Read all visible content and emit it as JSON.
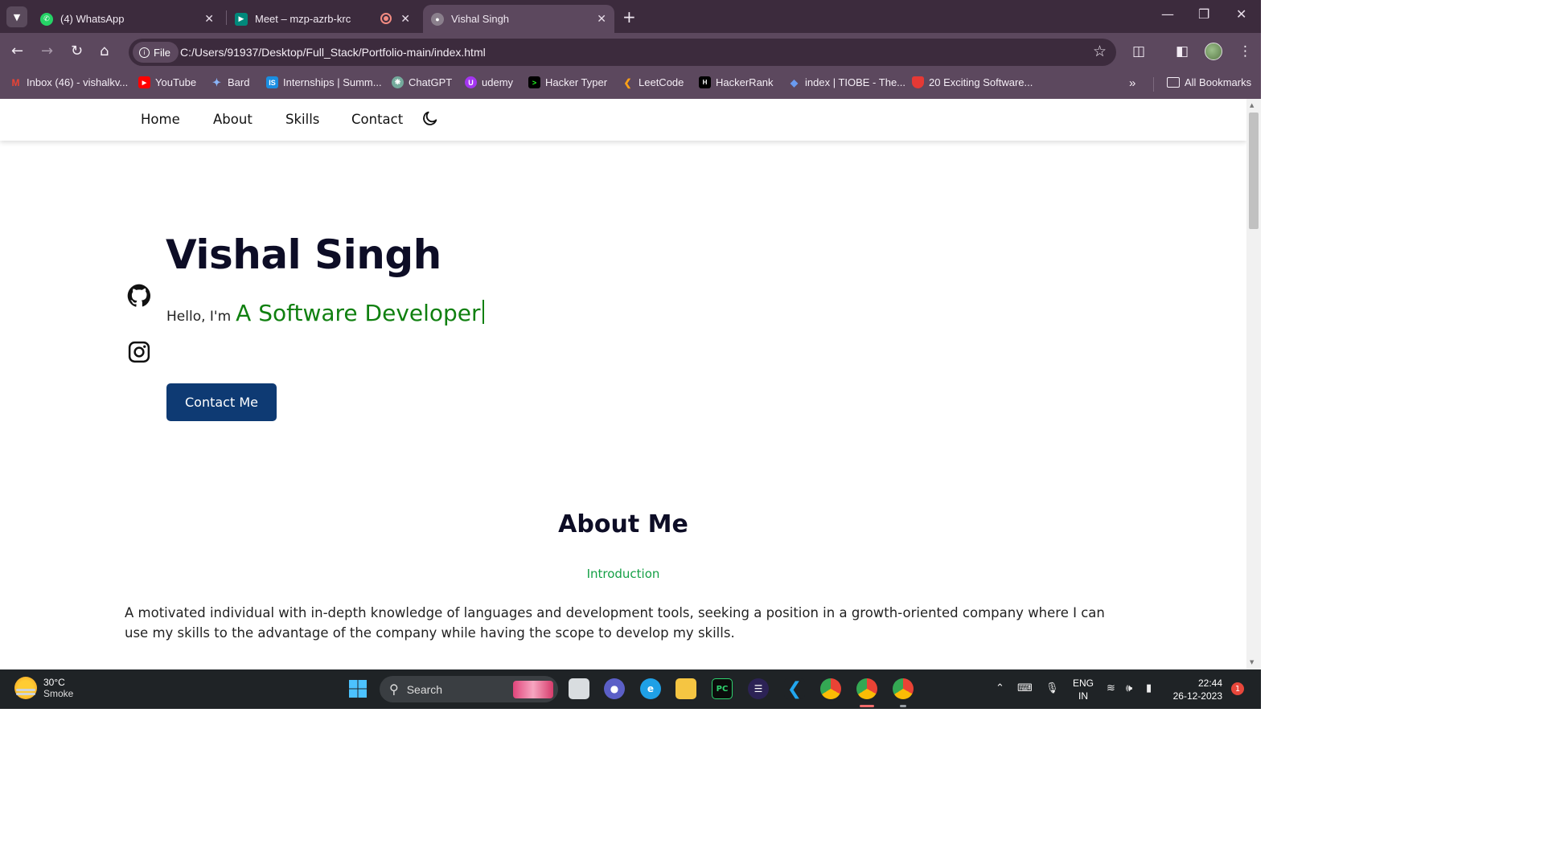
{
  "browser": {
    "tabs": [
      {
        "title": "(4) WhatsApp",
        "favicon": "whatsapp-icon",
        "color": "#25d366"
      },
      {
        "title": "Meet – mzp-azrb-krc",
        "favicon": "google-meet-icon",
        "color": "#00897b"
      },
      {
        "title": "Vishal Singh",
        "favicon": "globe-icon",
        "color": "#8a7f8c",
        "active": true
      }
    ],
    "address": {
      "scheme_label": "File",
      "url": "C:/Users/91937/Desktop/Full_Stack/Portfolio-main/index.html"
    },
    "bookmarks": [
      {
        "label": "Inbox (46) - vishalkv...",
        "icon": "gmail-icon",
        "color": "#ea4335"
      },
      {
        "label": "YouTube",
        "icon": "youtube-icon",
        "color": "#ff0000"
      },
      {
        "label": "Bard",
        "icon": "bard-icon",
        "color": "#8ab4f8"
      },
      {
        "label": "Internships | Summ...",
        "icon": "internshala-icon",
        "color": "#1a8ee1"
      },
      {
        "label": "ChatGPT",
        "icon": "chatgpt-icon",
        "color": "#74aa9c"
      },
      {
        "label": "udemy",
        "icon": "udemy-icon",
        "color": "#a435f0"
      },
      {
        "label": "Hacker Typer",
        "icon": "terminal-icon",
        "color": "#000000"
      },
      {
        "label": "LeetCode",
        "icon": "leetcode-icon",
        "color": "#ffa116"
      },
      {
        "label": "HackerRank",
        "icon": "hackerrank-icon",
        "color": "#000000"
      },
      {
        "label": "index | TIOBE - The...",
        "icon": "tiobe-icon",
        "color": "#3a6fd8"
      },
      {
        "label": "20 Exciting Software...",
        "icon": "bookmark-page-icon",
        "color": "#e53935"
      }
    ],
    "all_bookmarks_label": "All Bookmarks"
  },
  "site": {
    "nav": [
      "Home",
      "About",
      "Skills",
      "Contact"
    ],
    "hero": {
      "name": "Vishal Singh",
      "greeting": "Hello, I'm",
      "role": "A Software Developer",
      "cta": "Contact Me"
    },
    "about": {
      "title": "About Me",
      "subtitle": "Introduction",
      "text": "A motivated individual with in-depth knowledge of languages and development tools, seeking a position in a growth-oriented company where I can use my skills to the advantage of the company while having the scope to develop my skills."
    },
    "colors": {
      "accent_green": "#108010",
      "button_blue": "#0e3a73",
      "heading": "#0d0d26"
    }
  },
  "taskbar": {
    "weather": {
      "temp": "30°C",
      "condition": "Smoke"
    },
    "search_label": "Search",
    "lang": {
      "line1": "ENG",
      "line2": "IN"
    },
    "clock": {
      "time": "22:44",
      "date": "26-12-2023"
    },
    "notification_count": "1"
  }
}
